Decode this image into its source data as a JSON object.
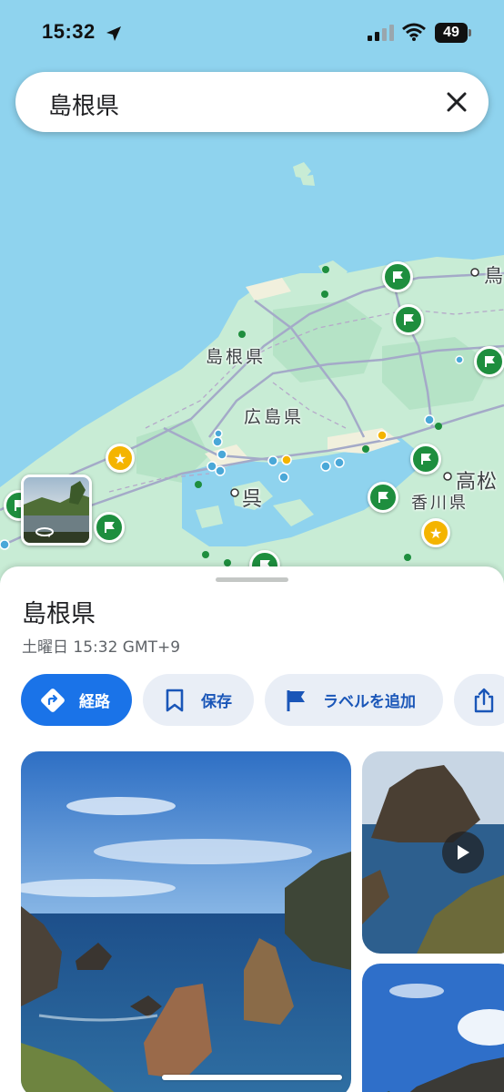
{
  "status_bar": {
    "time": "15:32",
    "battery": "49",
    "icons": [
      "location-arrow-icon",
      "cellular-signal-icon",
      "wifi-icon",
      "battery-icon"
    ]
  },
  "search": {
    "query": "島根県",
    "clear_icon": "close-icon"
  },
  "map": {
    "labels": {
      "shimane": "島根県",
      "hiroshima": "広島県",
      "kure": "呉",
      "takamatsu": "高松",
      "kagawa": "香川県",
      "tottori_partial": "鳥"
    },
    "colors": {
      "sea": "#8fd3ee",
      "land": "#c8ecd5",
      "road": "#a4aac8",
      "pin_green": "#1e8e3e",
      "pin_star": "#f4b400"
    }
  },
  "place": {
    "title": "島根県",
    "subtitle": "土曜日 15:32 GMT+9"
  },
  "actions": {
    "route": "経路",
    "save": "保存",
    "add_label": "ラベルを追加"
  },
  "colors": {
    "primary": "#1a73e8",
    "chip_bg": "#e9eef6",
    "chip_text": "#1a56b8"
  }
}
